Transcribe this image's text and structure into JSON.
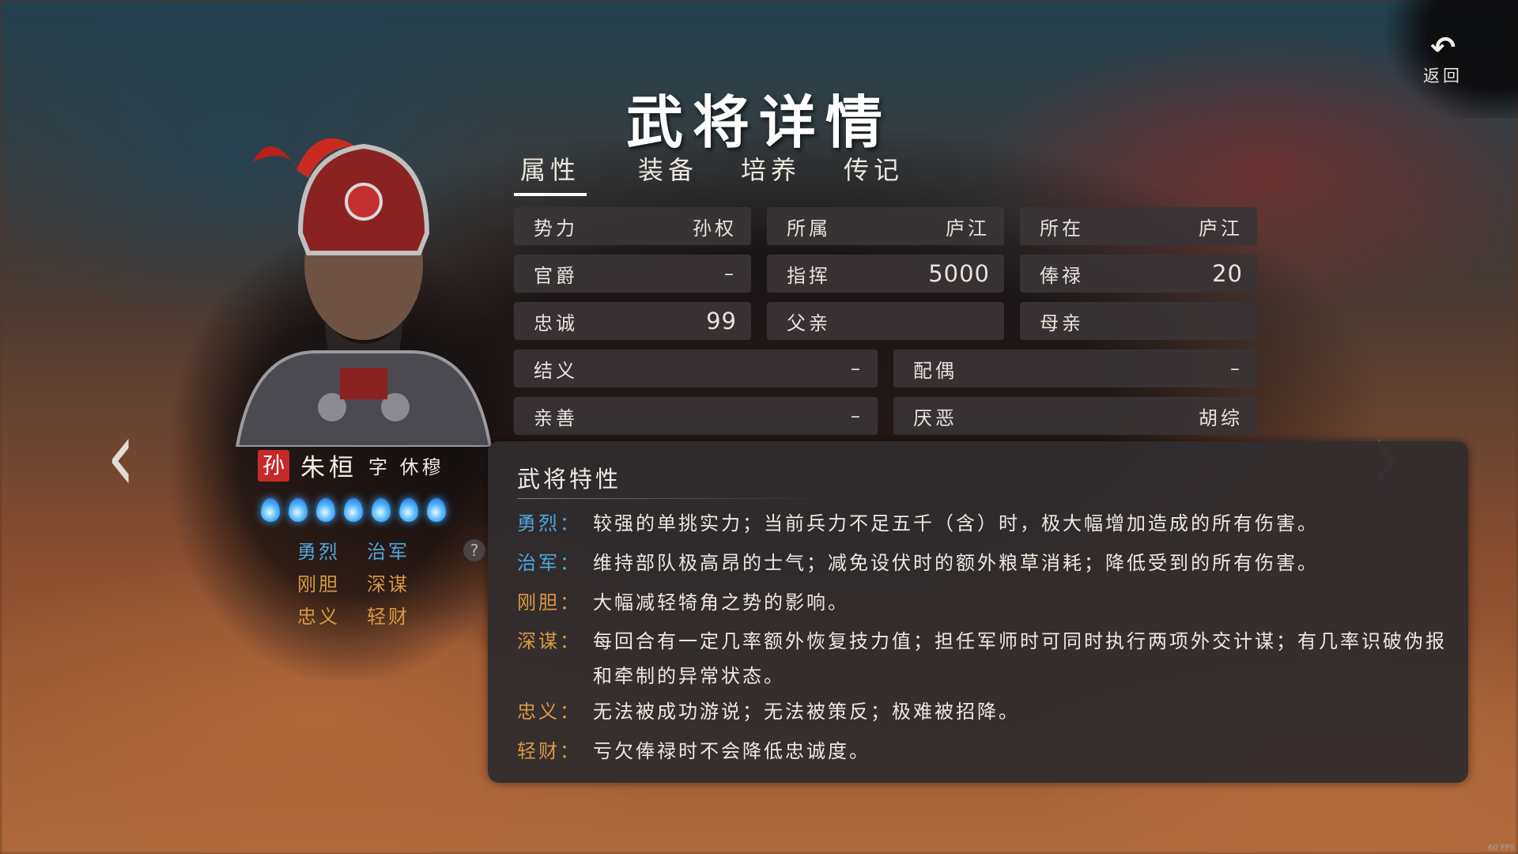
{
  "header": {
    "title": "武将详情",
    "back_label": "返回"
  },
  "tabs": [
    {
      "label": "属性",
      "active": true
    },
    {
      "label": "装备",
      "active": false
    },
    {
      "label": "培养",
      "active": false
    },
    {
      "label": "传记",
      "active": false
    }
  ],
  "attributes": {
    "faction": {
      "label": "势力",
      "value": "孙权"
    },
    "belong": {
      "label": "所属",
      "value": "庐江"
    },
    "location": {
      "label": "所在",
      "value": "庐江"
    },
    "rank": {
      "label": "官爵",
      "value": "–"
    },
    "command": {
      "label": "指挥",
      "value": "5000"
    },
    "salary": {
      "label": "俸禄",
      "value": "20"
    },
    "loyalty": {
      "label": "忠诚",
      "value": "99"
    },
    "father": {
      "label": "父亲",
      "value": ""
    },
    "mother": {
      "label": "母亲",
      "value": ""
    },
    "sworn": {
      "label": "结义",
      "value": "–"
    },
    "spouse": {
      "label": "配偶",
      "value": "–"
    },
    "friendly": {
      "label": "亲善",
      "value": "–"
    },
    "dislike": {
      "label": "厌恶",
      "value": "胡综"
    }
  },
  "general": {
    "seal": "孙",
    "name": "朱桓",
    "courtesy": "字 休穆",
    "stars": 7,
    "traits": [
      {
        "label": "勇烈",
        "color": "#4fa6dc"
      },
      {
        "label": "治军",
        "color": "#4fa6dc"
      },
      {
        "label": "刚胆",
        "color": "#d79a40"
      },
      {
        "label": "深谋",
        "color": "#d79a40"
      },
      {
        "label": "忠义",
        "color": "#d79a40"
      },
      {
        "label": "轻财",
        "color": "#d79a40"
      }
    ],
    "help": "?"
  },
  "traits_panel": {
    "title": "武将特性",
    "items": [
      {
        "key": "勇烈：",
        "desc": "较强的单挑实力；当前兵力不足五千（含）时，极大幅增加造成的所有伤害。"
      },
      {
        "key": "治军：",
        "desc": "维持部队极高昂的士气；减免设伏时的额外粮草消耗；降低受到的所有伤害。"
      },
      {
        "key": "刚胆：",
        "desc": "大幅减轻犄角之势的影响。"
      },
      {
        "key": "深谋：",
        "desc": "每回合有一定几率额外恢复技力值；担任军师时可同时执行两项外交计谋；有几率识破伪报和牵制的异常状态。"
      },
      {
        "key": "忠义：",
        "desc": "无法被成功游说；无法被策反；极难被招降。"
      },
      {
        "key": "轻财：",
        "desc": "亏欠俸禄时不会降低忠诚度。"
      }
    ]
  },
  "nav": {
    "prev": "‹",
    "next": "›"
  },
  "fps": "60 FPS",
  "colors": {
    "blue_trait": "#4fa6dc",
    "gold_trait": "#d79a40",
    "seal_red": "#c42a2a"
  }
}
